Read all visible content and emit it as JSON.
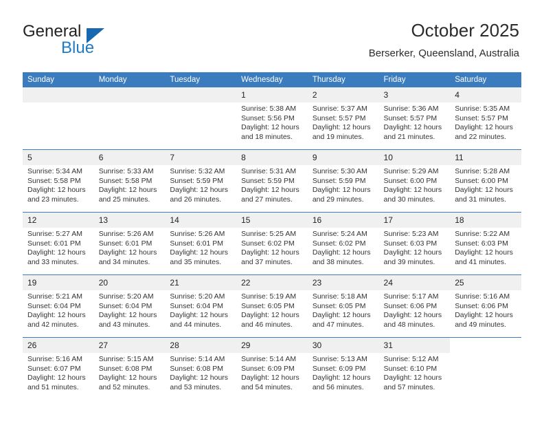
{
  "brand": {
    "name_top": "General",
    "name_bottom": "Blue",
    "triangle_color": "#1668b0",
    "blue_text_color": "#1f7bc4"
  },
  "header": {
    "title": "October 2025",
    "location": "Berserker, Queensland, Australia"
  },
  "theme": {
    "header_blue": "#3a7cbe",
    "daynum_band": "#f0f0f0",
    "text": "#333333"
  },
  "weekdays": [
    "Sunday",
    "Monday",
    "Tuesday",
    "Wednesday",
    "Thursday",
    "Friday",
    "Saturday"
  ],
  "labels": {
    "sunrise_prefix": "Sunrise:",
    "sunset_prefix": "Sunset:",
    "daylight_prefix": "Daylight:"
  },
  "weeks": [
    [
      {
        "blank": true,
        "type": "empty"
      },
      {
        "blank": true,
        "type": "empty"
      },
      {
        "blank": true,
        "type": "empty"
      },
      {
        "day": "1",
        "sunrise": "Sunrise: 5:38 AM",
        "sunset": "Sunset: 5:56 PM",
        "daylight_l1": "Daylight: 12 hours",
        "daylight_l2": "and 18 minutes."
      },
      {
        "day": "2",
        "sunrise": "Sunrise: 5:37 AM",
        "sunset": "Sunset: 5:57 PM",
        "daylight_l1": "Daylight: 12 hours",
        "daylight_l2": "and 19 minutes."
      },
      {
        "day": "3",
        "sunrise": "Sunrise: 5:36 AM",
        "sunset": "Sunset: 5:57 PM",
        "daylight_l1": "Daylight: 12 hours",
        "daylight_l2": "and 21 minutes."
      },
      {
        "day": "4",
        "sunrise": "Sunrise: 5:35 AM",
        "sunset": "Sunset: 5:57 PM",
        "daylight_l1": "Daylight: 12 hours",
        "daylight_l2": "and 22 minutes."
      }
    ],
    [
      {
        "day": "5",
        "sunrise": "Sunrise: 5:34 AM",
        "sunset": "Sunset: 5:58 PM",
        "daylight_l1": "Daylight: 12 hours",
        "daylight_l2": "and 23 minutes."
      },
      {
        "day": "6",
        "sunrise": "Sunrise: 5:33 AM",
        "sunset": "Sunset: 5:58 PM",
        "daylight_l1": "Daylight: 12 hours",
        "daylight_l2": "and 25 minutes."
      },
      {
        "day": "7",
        "sunrise": "Sunrise: 5:32 AM",
        "sunset": "Sunset: 5:59 PM",
        "daylight_l1": "Daylight: 12 hours",
        "daylight_l2": "and 26 minutes."
      },
      {
        "day": "8",
        "sunrise": "Sunrise: 5:31 AM",
        "sunset": "Sunset: 5:59 PM",
        "daylight_l1": "Daylight: 12 hours",
        "daylight_l2": "and 27 minutes."
      },
      {
        "day": "9",
        "sunrise": "Sunrise: 5:30 AM",
        "sunset": "Sunset: 5:59 PM",
        "daylight_l1": "Daylight: 12 hours",
        "daylight_l2": "and 29 minutes."
      },
      {
        "day": "10",
        "sunrise": "Sunrise: 5:29 AM",
        "sunset": "Sunset: 6:00 PM",
        "daylight_l1": "Daylight: 12 hours",
        "daylight_l2": "and 30 minutes."
      },
      {
        "day": "11",
        "sunrise": "Sunrise: 5:28 AM",
        "sunset": "Sunset: 6:00 PM",
        "daylight_l1": "Daylight: 12 hours",
        "daylight_l2": "and 31 minutes."
      }
    ],
    [
      {
        "day": "12",
        "sunrise": "Sunrise: 5:27 AM",
        "sunset": "Sunset: 6:01 PM",
        "daylight_l1": "Daylight: 12 hours",
        "daylight_l2": "and 33 minutes."
      },
      {
        "day": "13",
        "sunrise": "Sunrise: 5:26 AM",
        "sunset": "Sunset: 6:01 PM",
        "daylight_l1": "Daylight: 12 hours",
        "daylight_l2": "and 34 minutes."
      },
      {
        "day": "14",
        "sunrise": "Sunrise: 5:26 AM",
        "sunset": "Sunset: 6:01 PM",
        "daylight_l1": "Daylight: 12 hours",
        "daylight_l2": "and 35 minutes."
      },
      {
        "day": "15",
        "sunrise": "Sunrise: 5:25 AM",
        "sunset": "Sunset: 6:02 PM",
        "daylight_l1": "Daylight: 12 hours",
        "daylight_l2": "and 37 minutes."
      },
      {
        "day": "16",
        "sunrise": "Sunrise: 5:24 AM",
        "sunset": "Sunset: 6:02 PM",
        "daylight_l1": "Daylight: 12 hours",
        "daylight_l2": "and 38 minutes."
      },
      {
        "day": "17",
        "sunrise": "Sunrise: 5:23 AM",
        "sunset": "Sunset: 6:03 PM",
        "daylight_l1": "Daylight: 12 hours",
        "daylight_l2": "and 39 minutes."
      },
      {
        "day": "18",
        "sunrise": "Sunrise: 5:22 AM",
        "sunset": "Sunset: 6:03 PM",
        "daylight_l1": "Daylight: 12 hours",
        "daylight_l2": "and 41 minutes."
      }
    ],
    [
      {
        "day": "19",
        "sunrise": "Sunrise: 5:21 AM",
        "sunset": "Sunset: 6:04 PM",
        "daylight_l1": "Daylight: 12 hours",
        "daylight_l2": "and 42 minutes."
      },
      {
        "day": "20",
        "sunrise": "Sunrise: 5:20 AM",
        "sunset": "Sunset: 6:04 PM",
        "daylight_l1": "Daylight: 12 hours",
        "daylight_l2": "and 43 minutes."
      },
      {
        "day": "21",
        "sunrise": "Sunrise: 5:20 AM",
        "sunset": "Sunset: 6:04 PM",
        "daylight_l1": "Daylight: 12 hours",
        "daylight_l2": "and 44 minutes."
      },
      {
        "day": "22",
        "sunrise": "Sunrise: 5:19 AM",
        "sunset": "Sunset: 6:05 PM",
        "daylight_l1": "Daylight: 12 hours",
        "daylight_l2": "and 46 minutes."
      },
      {
        "day": "23",
        "sunrise": "Sunrise: 5:18 AM",
        "sunset": "Sunset: 6:05 PM",
        "daylight_l1": "Daylight: 12 hours",
        "daylight_l2": "and 47 minutes."
      },
      {
        "day": "24",
        "sunrise": "Sunrise: 5:17 AM",
        "sunset": "Sunset: 6:06 PM",
        "daylight_l1": "Daylight: 12 hours",
        "daylight_l2": "and 48 minutes."
      },
      {
        "day": "25",
        "sunrise": "Sunrise: 5:16 AM",
        "sunset": "Sunset: 6:06 PM",
        "daylight_l1": "Daylight: 12 hours",
        "daylight_l2": "and 49 minutes."
      }
    ],
    [
      {
        "day": "26",
        "sunrise": "Sunrise: 5:16 AM",
        "sunset": "Sunset: 6:07 PM",
        "daylight_l1": "Daylight: 12 hours",
        "daylight_l2": "and 51 minutes."
      },
      {
        "day": "27",
        "sunrise": "Sunrise: 5:15 AM",
        "sunset": "Sunset: 6:08 PM",
        "daylight_l1": "Daylight: 12 hours",
        "daylight_l2": "and 52 minutes."
      },
      {
        "day": "28",
        "sunrise": "Sunrise: 5:14 AM",
        "sunset": "Sunset: 6:08 PM",
        "daylight_l1": "Daylight: 12 hours",
        "daylight_l2": "and 53 minutes."
      },
      {
        "day": "29",
        "sunrise": "Sunrise: 5:14 AM",
        "sunset": "Sunset: 6:09 PM",
        "daylight_l1": "Daylight: 12 hours",
        "daylight_l2": "and 54 minutes."
      },
      {
        "day": "30",
        "sunrise": "Sunrise: 5:13 AM",
        "sunset": "Sunset: 6:09 PM",
        "daylight_l1": "Daylight: 12 hours",
        "daylight_l2": "and 56 minutes."
      },
      {
        "day": "31",
        "sunrise": "Sunrise: 5:12 AM",
        "sunset": "Sunset: 6:10 PM",
        "daylight_l1": "Daylight: 12 hours",
        "daylight_l2": "and 57 minutes."
      },
      {
        "blank": true,
        "type": "blank"
      }
    ]
  ]
}
